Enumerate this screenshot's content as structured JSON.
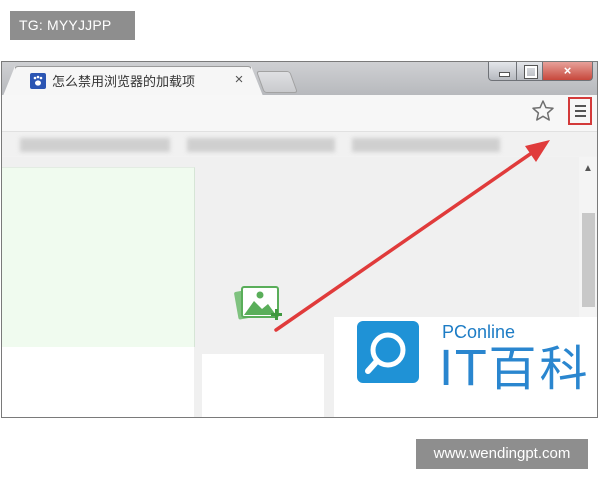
{
  "overlay": {
    "tag_text": "TG: MYYJJPP",
    "watermark_text": "www.wendingpt.com"
  },
  "browser": {
    "tab": {
      "title": "怎么禁用浏览器的加载项",
      "favicon": "baidu-paw-icon",
      "close_glyph": "×"
    },
    "window_buttons": {
      "minimize": "minimize-icon",
      "maximize": "maximize-icon",
      "close_glyph": "×"
    },
    "toolbar": {
      "bookmark_star": "star-icon",
      "menu_glyph": "≡"
    },
    "annotation_color": "#d33a3a"
  },
  "logo": {
    "brand_sub": "PConline",
    "brand_main": "IT百科",
    "accent": "#1f92d6"
  }
}
